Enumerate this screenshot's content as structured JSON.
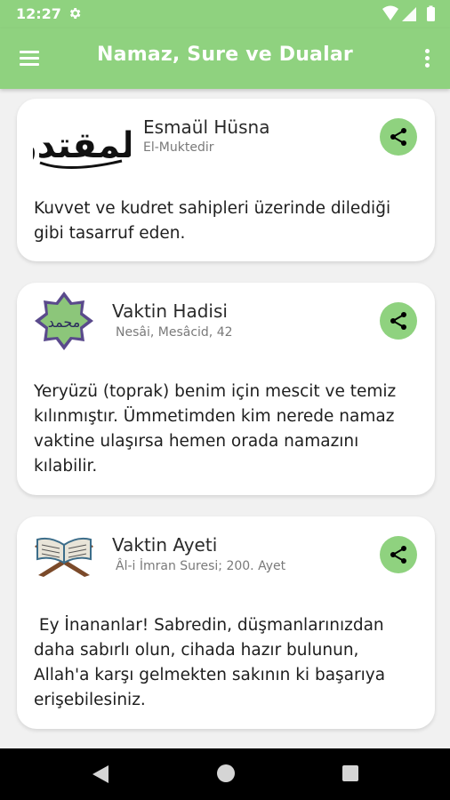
{
  "status_bar": {
    "time": "12:27",
    "left_icon": "gear-icon",
    "right_icons": [
      "wifi-icon",
      "signal-icon",
      "battery-icon"
    ]
  },
  "app_bar": {
    "title": "Namaz, Sure ve Dualar",
    "menu_icon": "hamburger-menu-icon",
    "overflow_icon": "more-vert-icon"
  },
  "cards": [
    {
      "title": "Esmaül Hüsna",
      "subtitle": "El-Muktedir",
      "body": "Kuvvet ve kudret sahipleri üzerinde dilediği gibi tasarruf eden.",
      "arabic": "المقتدر",
      "icon": "arabic-calligraphy-icon"
    },
    {
      "title": "Vaktin Hadisi",
      "subtitle": "Nesâi, Mesâcid, 42",
      "body": "Yeryüzü (toprak) benim için mescit ve temiz kılınmıştır. Ümmetimden kim nerede namaz vaktine ulaşırsa hemen orada namazını kılabilir.",
      "arabic": "محمد",
      "icon": "muhammad-calligraphy-star-icon"
    },
    {
      "title": "Vaktin Ayeti",
      "subtitle": "Âl-i İmran Suresi; 200. Ayet",
      "body": " Ey İnananlar! Sabredin, düşmanlarınızdan daha sabırlı olun, cihada hazır bulunun, Allah'a karşı gelmekten sakının ki başarıya erişebilesiniz.",
      "icon": "quran-book-icon"
    }
  ],
  "share_icon": "share-icon",
  "nav_bar": {
    "back": "back-triangle-icon",
    "home": "home-circle-icon",
    "recents": "recents-square-icon"
  },
  "colors": {
    "accent": "#8fd27f",
    "background": "#f1f1f1",
    "card": "#ffffff",
    "nav": "#000000"
  }
}
